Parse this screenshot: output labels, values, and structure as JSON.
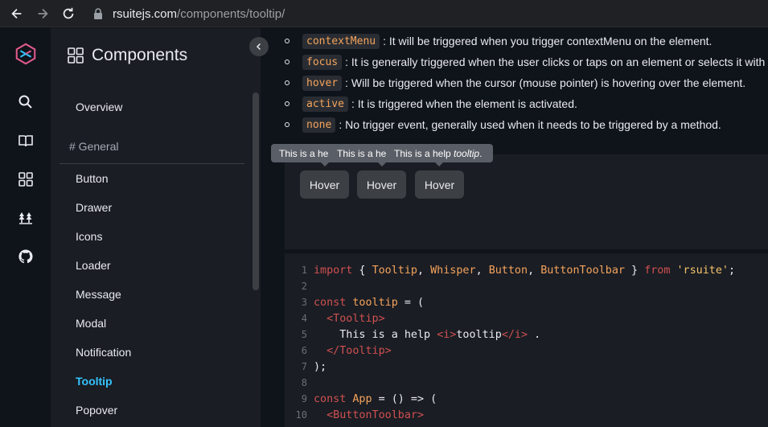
{
  "browser": {
    "url_domain": "rsuitejs.com",
    "url_path": "/components/tooltip/"
  },
  "sidebar": {
    "title": "Components",
    "overview": "Overview",
    "group": "# General",
    "items": [
      {
        "label": "Button"
      },
      {
        "label": "Drawer"
      },
      {
        "label": "Icons"
      },
      {
        "label": "Loader"
      },
      {
        "label": "Message"
      },
      {
        "label": "Modal"
      },
      {
        "label": "Notification"
      },
      {
        "label": "Tooltip"
      },
      {
        "label": "Popover"
      }
    ],
    "active_item": "Tooltip"
  },
  "triggers": [
    {
      "code": "contextMenu",
      "desc": ": It will be triggered when you trigger contextMenu on the element."
    },
    {
      "code": "focus",
      "desc": ": It is generally triggered when the user clicks or taps on an element or selects it with the keyboard."
    },
    {
      "code": "hover",
      "desc": ": Will be triggered when the cursor (mouse pointer) is hovering over the element."
    },
    {
      "code": "active",
      "desc": ": It is triggered when the element is activated."
    },
    {
      "code": "none",
      "desc": ": No trigger event, generally used when it needs to be triggered by a method."
    }
  ],
  "demo": {
    "tooltips": [
      "This is a he",
      "This is a he",
      "This is a help"
    ],
    "tooltip_italic": "tooltip",
    "tooltip_end": " .",
    "buttons": [
      "Hover",
      "Hover",
      "Hover"
    ]
  },
  "code": {
    "line1": {
      "n": "1",
      "import": "import",
      "brace_open": " { ",
      "a": "Tooltip",
      "c1": ", ",
      "b": "Whisper",
      "c2": ", ",
      "c": "Button",
      "c3": ", ",
      "d": "ButtonToolbar",
      "brace_close": " } ",
      "from": "from",
      "sp": " ",
      "src": "'rsuite'",
      "semi": ";"
    },
    "line2": {
      "n": "2"
    },
    "line3": {
      "n": "3",
      "kw": "const",
      "name": " tooltip",
      "rest": " = ("
    },
    "line4": {
      "n": "4",
      "tag": "  <Tooltip>"
    },
    "line5": {
      "n": "5",
      "text": "    This is a help ",
      "i_open": "<i>",
      "inner": "tooltip",
      "i_close": "</i>",
      "end": " ."
    },
    "line6": {
      "n": "6",
      "tag": "  </Tooltip>"
    },
    "line7": {
      "n": "7",
      "text": ");"
    },
    "line8": {
      "n": "8"
    },
    "line9": {
      "n": "9",
      "kw": "const",
      "name": " App",
      "rest": " = () => ("
    },
    "line10": {
      "n": "10",
      "tag": "  <ButtonToolbar>"
    }
  },
  "colors": {
    "accent": "#34c3ff",
    "code_orange": "#f5a35b",
    "code_red": "#d05050",
    "code_string": "#f5c46b"
  }
}
